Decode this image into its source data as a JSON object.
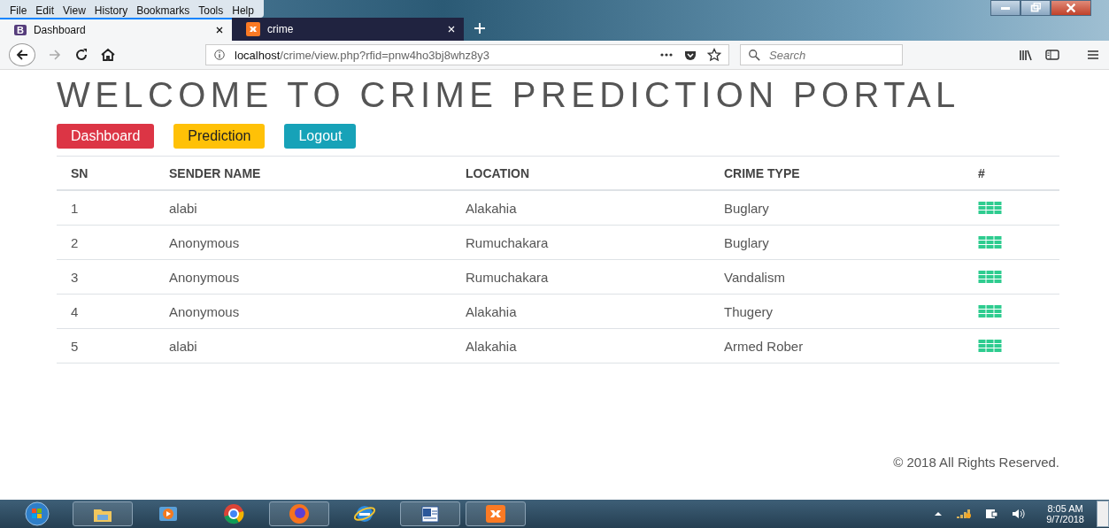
{
  "menu_bar": [
    "File",
    "Edit",
    "View",
    "History",
    "Bookmarks",
    "Tools",
    "Help"
  ],
  "tabs": [
    {
      "label": "Dashboard",
      "icon_text": "B",
      "selected": true,
      "kind": "letter"
    },
    {
      "label": "crime",
      "selected": false,
      "kind": "logo"
    }
  ],
  "address_bar": {
    "host": "localhost",
    "path": "/crime/view.php?rfid=pnw4ho3bj8whz8y3"
  },
  "search": {
    "placeholder": "Search"
  },
  "page": {
    "title": "WELCOME TO CRIME PREDICTION PORTAL",
    "buttons": [
      {
        "label": "Dashboard",
        "color": "#dc3545"
      },
      {
        "label": "Prediction",
        "color": "#ffc107"
      },
      {
        "label": "Logout",
        "color": "#17a2b8"
      }
    ],
    "table": {
      "columns": [
        "SN",
        "SENDER NAME",
        "LOCATION",
        "CRIME TYPE",
        "#"
      ],
      "rows": [
        [
          "1",
          "alabi",
          "Alakahia",
          "Buglary"
        ],
        [
          "2",
          "Anonymous",
          "Rumuchakara",
          "Buglary"
        ],
        [
          "3",
          "Anonymous",
          "Rumuchakara",
          "Vandalism"
        ],
        [
          "4",
          "Anonymous",
          "Alakahia",
          "Thugery"
        ],
        [
          "5",
          "alabi",
          "Alakahia",
          "Armed Rober"
        ]
      ]
    },
    "footer": "© 2018 All Rights Reserved."
  },
  "taskbar": {
    "time": "8:05 AM",
    "date": "9/7/2018"
  }
}
